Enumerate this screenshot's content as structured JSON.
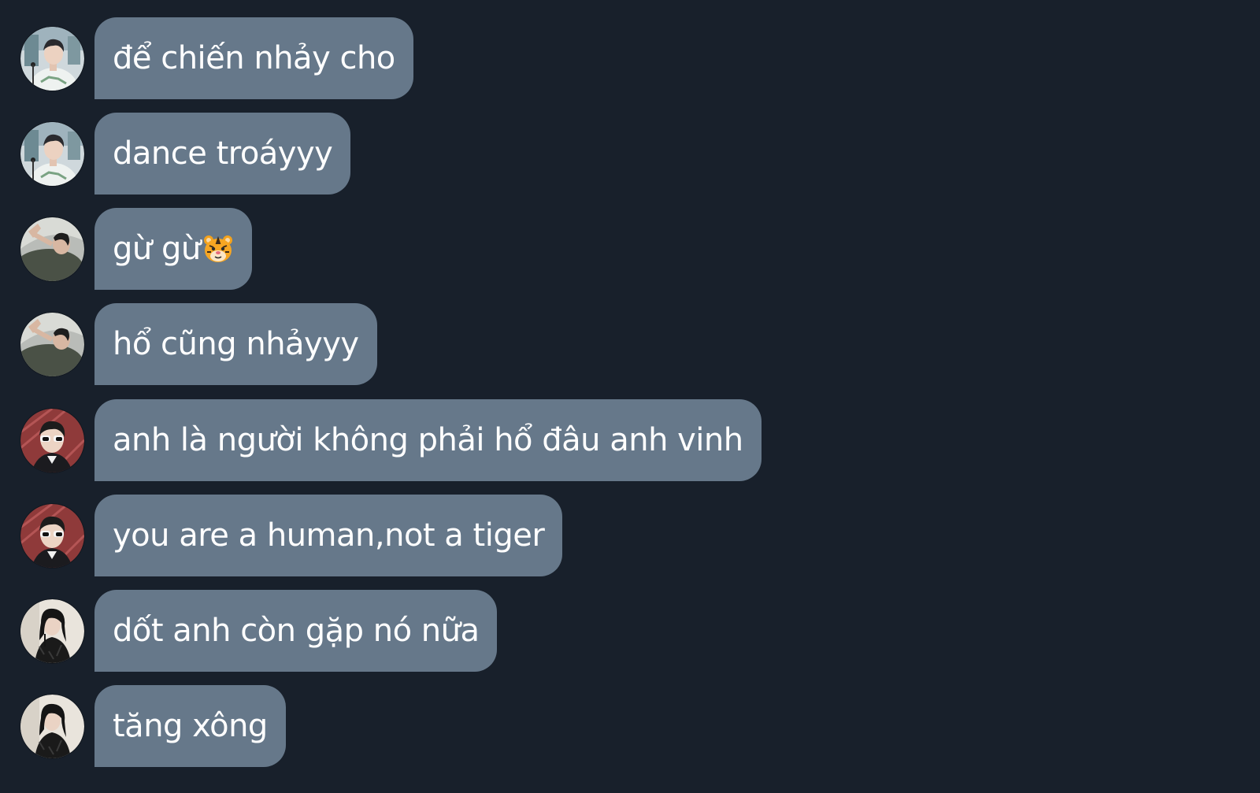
{
  "messages": [
    {
      "text": "để chiến nhảy cho",
      "avatar": "avatar-white-shirt-icon"
    },
    {
      "text": "dance troáyyy",
      "avatar": "avatar-white-shirt-icon"
    },
    {
      "text": "gừ gừ",
      "emoji": "tiger-face-icon",
      "avatar": "avatar-lying-down-icon"
    },
    {
      "text": "hổ cũng nhảyyy",
      "avatar": "avatar-lying-down-icon"
    },
    {
      "text": "anh là người không phải hổ đâu anh vinh",
      "avatar": "avatar-sunglasses-icon"
    },
    {
      "text": "you are a human,not a tiger",
      "avatar": "avatar-sunglasses-icon"
    },
    {
      "text": "dốt anh còn gặp nó nữa",
      "avatar": "avatar-black-dress-icon"
    },
    {
      "text": "tăng xông",
      "avatar": "avatar-black-dress-icon"
    }
  ],
  "colors": {
    "background": "#18202b",
    "bubble": "#66788a",
    "text": "#ffffff"
  }
}
